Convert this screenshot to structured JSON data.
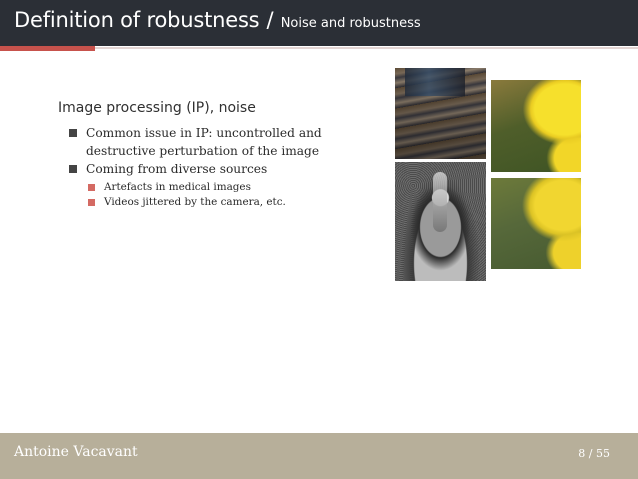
{
  "header": {
    "title": "Definition of robustness",
    "separator": "/",
    "subtitle": "Noise and robustness"
  },
  "block": {
    "title": "Image processing (IP), noise",
    "items": [
      {
        "text": "Common issue in IP: uncontrolled and destructive perturbation of the image"
      },
      {
        "text": "Coming from diverse sources",
        "subitems": [
          {
            "text": "Artefacts in medical images"
          },
          {
            "text": "Videos jittered by the camera, etc."
          }
        ]
      }
    ]
  },
  "footer": {
    "author": "Antoine Vacavant",
    "page": "8 / 55"
  },
  "colors": {
    "header_bg": "#2b2f36",
    "accent": "#c7524c",
    "footer_bg": "#b7af9a",
    "sub_bullet": "#d46a63"
  }
}
